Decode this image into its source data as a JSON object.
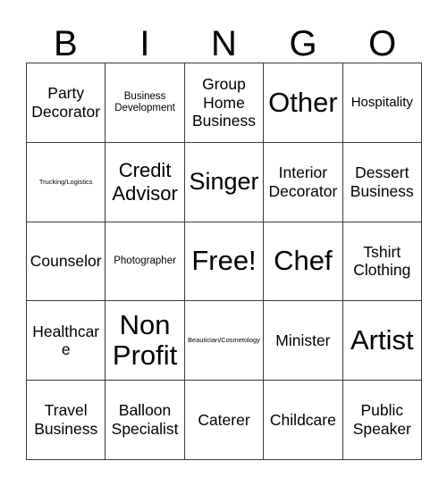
{
  "card": {
    "header_letters": [
      "B",
      "I",
      "N",
      "G",
      "O"
    ],
    "grid_columns": 5,
    "grid_rows": 5,
    "line_color": "#3a3a3a",
    "background_color": "#ffffff",
    "text_color": "#000000",
    "cells": [
      {
        "label": "Party Decorator",
        "size": "md",
        "free": false
      },
      {
        "label": "Business Development",
        "size": "xs",
        "free": false
      },
      {
        "label": "Group Home Business",
        "size": "md",
        "free": false
      },
      {
        "label": "Other",
        "size": "xxl",
        "free": false
      },
      {
        "label": "Hospitality",
        "size": "sm",
        "free": false
      },
      {
        "label": "Trucking/Logistics",
        "size": "xxs",
        "free": false
      },
      {
        "label": "Credit Advisor",
        "size": "lg",
        "free": false
      },
      {
        "label": "Singer",
        "size": "xl",
        "free": false
      },
      {
        "label": "Interior Decorator",
        "size": "md",
        "free": false
      },
      {
        "label": "Dessert Business",
        "size": "md",
        "free": false
      },
      {
        "label": "Counselor",
        "size": "md",
        "free": false
      },
      {
        "label": "Photographer",
        "size": "xs",
        "free": false
      },
      {
        "label": "Free!",
        "size": "xxl",
        "free": true
      },
      {
        "label": "Chef",
        "size": "xxl",
        "free": false
      },
      {
        "label": "Tshirt Clothing",
        "size": "md",
        "free": false
      },
      {
        "label": "Healthcare",
        "size": "md",
        "free": false
      },
      {
        "label": "Non Profit",
        "size": "xxl",
        "free": false
      },
      {
        "label": "Beautician/Cosmetology",
        "size": "xxs",
        "free": false
      },
      {
        "label": "Minister",
        "size": "md",
        "free": false
      },
      {
        "label": "Artist",
        "size": "xxl",
        "free": false
      },
      {
        "label": "Travel Business",
        "size": "md",
        "free": false
      },
      {
        "label": "Balloon Specialist",
        "size": "md",
        "free": false
      },
      {
        "label": "Caterer",
        "size": "md",
        "free": false
      },
      {
        "label": "Childcare",
        "size": "md",
        "free": false
      },
      {
        "label": "Public Speaker",
        "size": "md",
        "free": false
      }
    ]
  }
}
